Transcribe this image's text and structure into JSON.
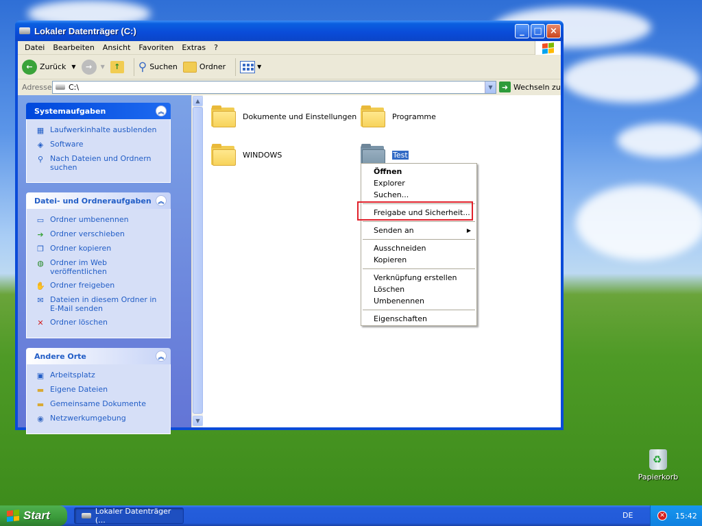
{
  "window": {
    "title": "Lokaler Datenträger (C:)",
    "controls": {
      "minimize": "_",
      "maximize": "□",
      "close": "×"
    }
  },
  "menubar": [
    "Datei",
    "Bearbeiten",
    "Ansicht",
    "Favoriten",
    "Extras",
    "?"
  ],
  "toolbar": {
    "back": "Zurück",
    "search": "Suchen",
    "folders": "Ordner"
  },
  "address": {
    "label": "Adresse",
    "value": "C:\\",
    "go": "Wechseln zu"
  },
  "taskpane": {
    "system": {
      "title": "Systemaufgaben",
      "items": [
        "Laufwerkinhalte ausblenden",
        "Software",
        "Nach Dateien und Ordnern suchen"
      ]
    },
    "file_tasks": {
      "title": "Datei- und Ordneraufgaben",
      "items": [
        "Ordner umbenennen",
        "Ordner verschieben",
        "Ordner kopieren",
        "Ordner im Web veröffentlichen",
        "Ordner freigeben",
        "Dateien in diesem Ordner in E-Mail senden",
        "Ordner löschen"
      ]
    },
    "other_places": {
      "title": "Andere Orte",
      "items": [
        "Arbeitsplatz",
        "Eigene Dateien",
        "Gemeinsame Dokumente",
        "Netzwerkumgebung"
      ]
    }
  },
  "files": [
    {
      "name": "Dokumente und Einstellungen"
    },
    {
      "name": "Programme"
    },
    {
      "name": "WINDOWS"
    },
    {
      "name": "Test"
    }
  ],
  "context_menu": {
    "items": [
      "Öffnen",
      "Explorer",
      "Suchen...",
      "Freigabe und Sicherheit...",
      "Senden an",
      "Ausschneiden",
      "Kopieren",
      "Verknüpfung erstellen",
      "Löschen",
      "Umbenennen",
      "Eigenschaften"
    ]
  },
  "desktop": {
    "recycle_bin": "Papierkorb"
  },
  "taskbar": {
    "start": "Start",
    "task": "Lokaler Datenträger (...",
    "lang": "DE",
    "clock": "15:42"
  },
  "colors": {
    "accent": "#0a4bd8",
    "highlight": "#e0202a",
    "link": "#215dc6"
  }
}
